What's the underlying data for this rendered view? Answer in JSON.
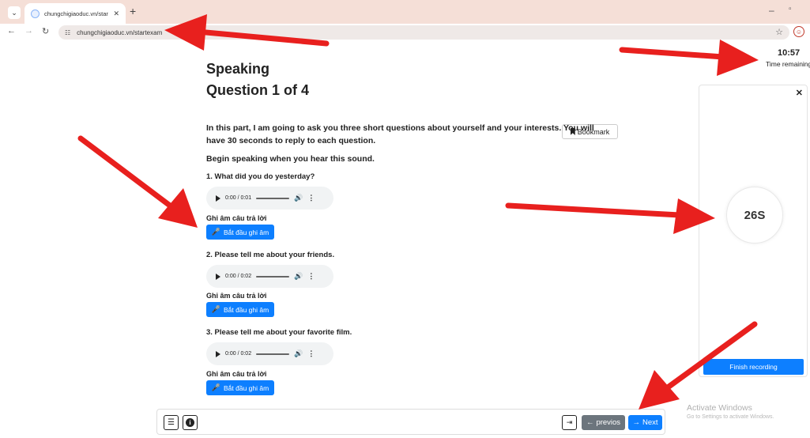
{
  "browser": {
    "tab_title": "chungchigiaoduc.vn/startexam",
    "url": "chungchigiaoduc.vn/startexam",
    "new_tab": "+",
    "tab_close": "✕"
  },
  "exam": {
    "section_title": "Speaking",
    "question_progress": "Question 1 of 4",
    "bookmark_label": "Bookmark",
    "instructions": "In this part, I am going to ask you three short questions about yourself and your interests. You will have 30 seconds to reply to each question.",
    "begin_prompt": "Begin speaking when you hear this sound.",
    "record_label": "Ghi âm câu trả lời",
    "record_button": "Bắt đầu ghi âm",
    "questions": [
      {
        "text": "1. What did you do yesterday?",
        "audio_time": "0:00 / 0:01"
      },
      {
        "text": "2. Please tell me about your friends.",
        "audio_time": "0:00 / 0:02"
      },
      {
        "text": "3. Please tell me about your favorite film.",
        "audio_time": "0:00 / 0:02"
      }
    ]
  },
  "timer": {
    "value": "10:57",
    "label": "Time remaining"
  },
  "recording_panel": {
    "countdown": "26S",
    "finish_label": "Finish recording"
  },
  "nav": {
    "previous_label": "previos",
    "next_label": "Next"
  },
  "watermark": {
    "title": "Activate Windows",
    "subtitle": "Go to Settings to activate Windows."
  },
  "colors": {
    "primary": "#0d7fff",
    "secondary": "#6c757d",
    "annotation_arrow": "#e8201e",
    "tabbar": "#f5dfd7"
  }
}
